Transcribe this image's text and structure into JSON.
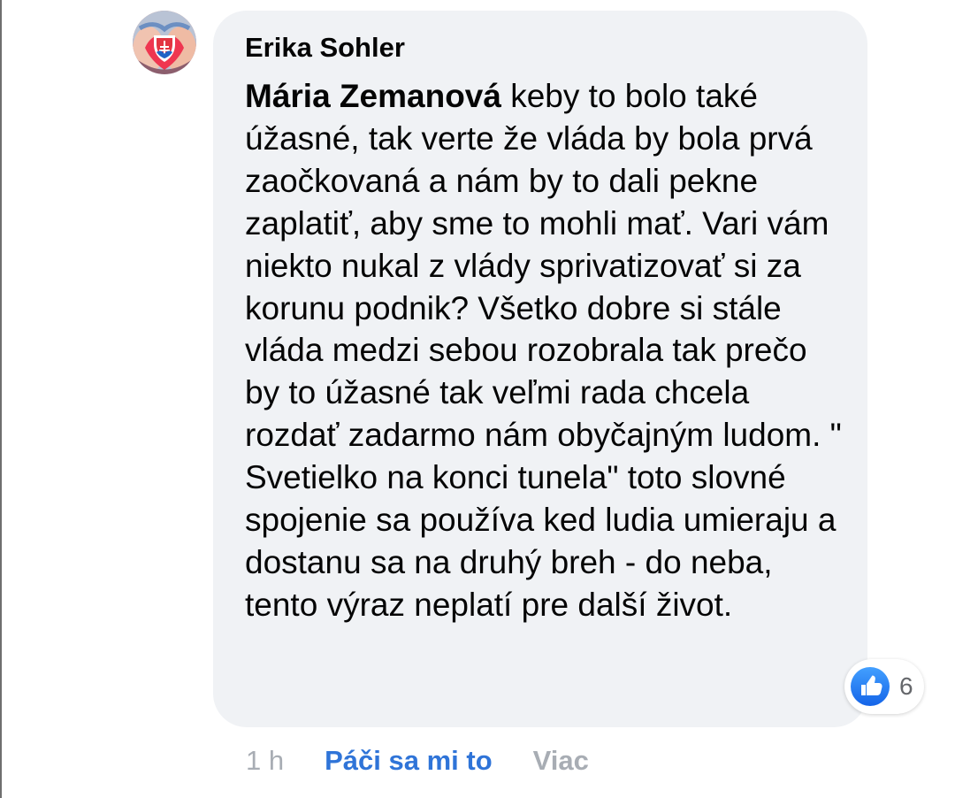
{
  "comment": {
    "author": "Erika Sohler",
    "mention": "Mária Zemanová",
    "text": " keby to bolo také úžasné, tak verte že vláda by bola prvá zaočkovaná a nám by to dali pekne zaplatiť, aby sme to mohli mať. Vari vám niekto nukal z vlády sprivatizovať si za korunu podnik? Všetko dobre si stále vláda medzi sebou rozobrala tak prečo by to úžasné tak veľmi rada chcela rozdať zadarmo nám obyčajným ludom. \" Svetielko na konci tunela\" toto slovné spojenie sa používa ked ludia umieraju a dostanu sa na druhý breh - do neba, tento výraz neplatí pre další život.",
    "reactions": {
      "count": "6",
      "icon": "thumbs-up-icon"
    },
    "meta": {
      "time": "1 h",
      "like_label": "Páči sa mi to",
      "more_label": "Viac"
    }
  },
  "colors": {
    "bubble_background": "#f0f2f5",
    "like_blue": "#2f74d8",
    "muted_text": "#a8adb4"
  }
}
